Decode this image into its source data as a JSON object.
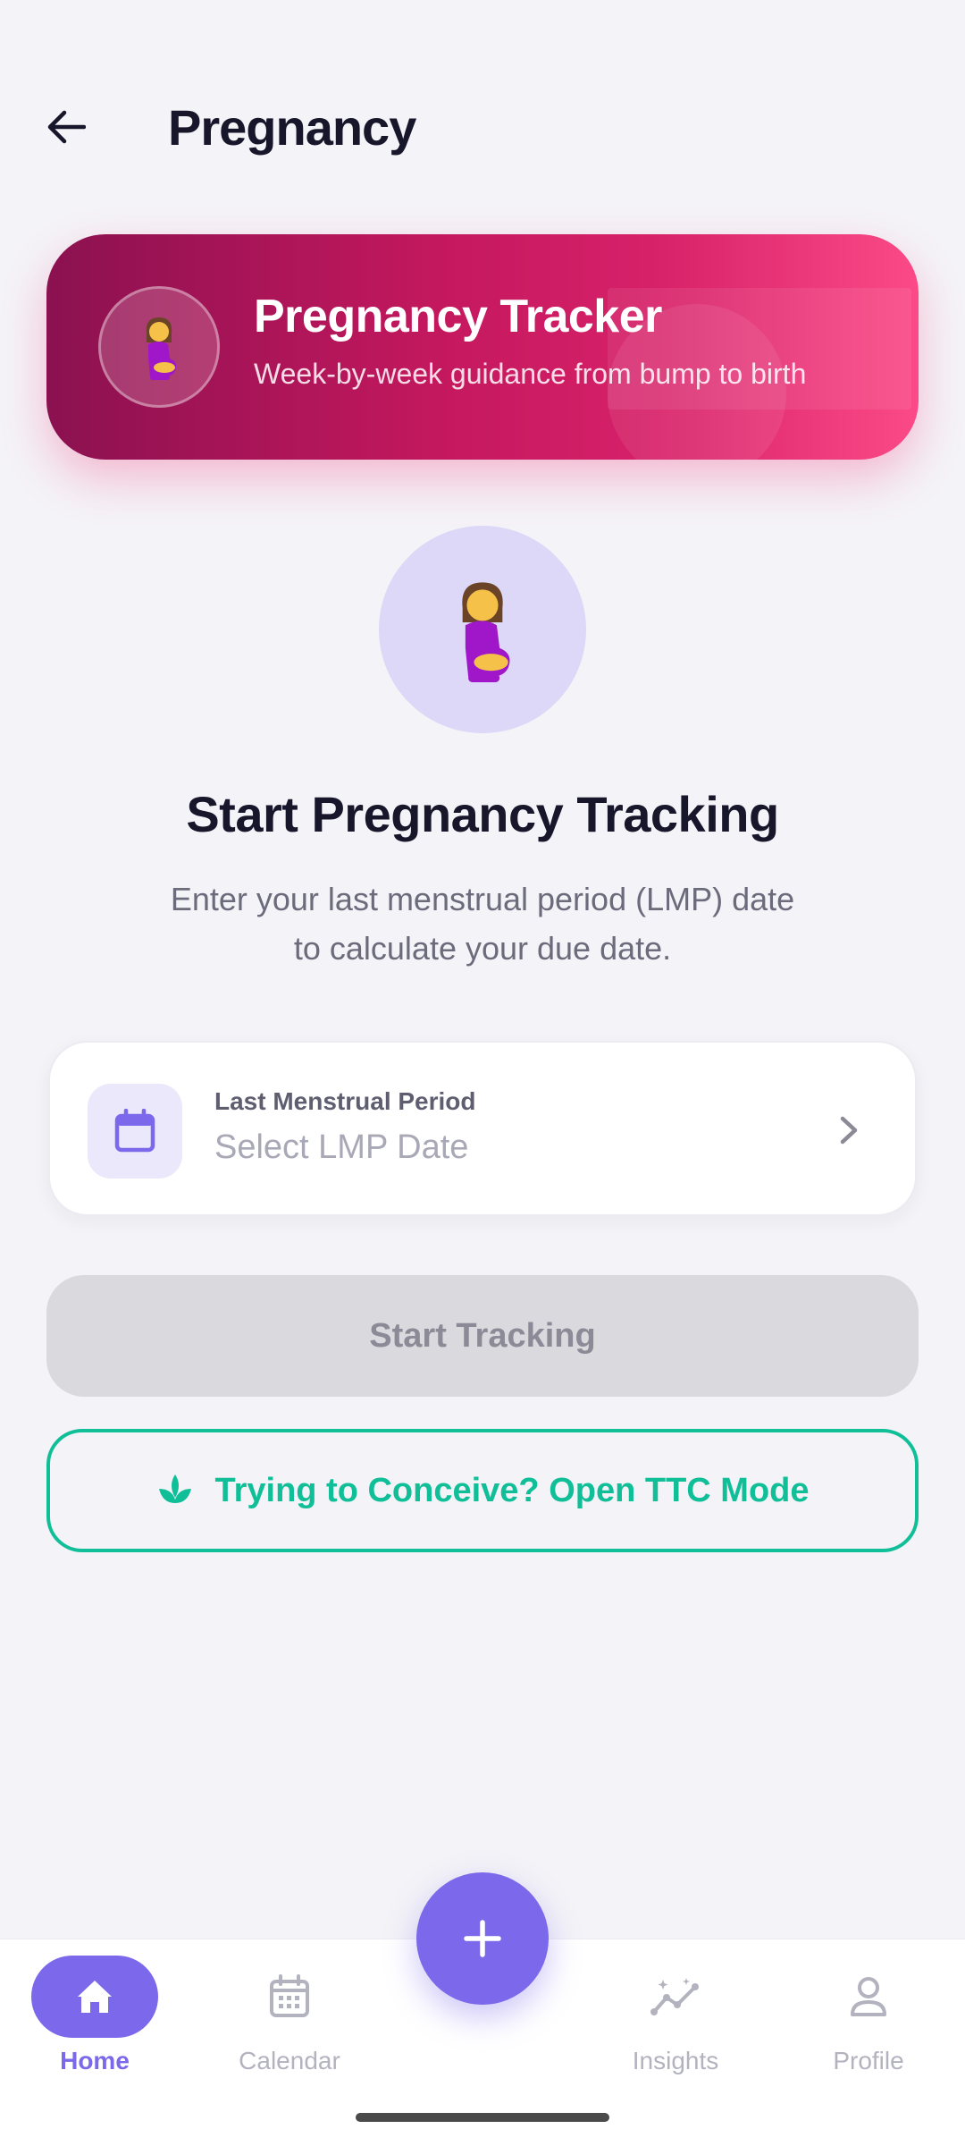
{
  "header": {
    "title": "Pregnancy",
    "back_icon": "arrow-left-icon"
  },
  "banner": {
    "title": "Pregnancy Tracker",
    "subtitle": "Week-by-week guidance from bump to birth",
    "icon": "pregnant-woman-emoji",
    "gradient": [
      "#8b1150",
      "#fb4a87"
    ]
  },
  "hero": {
    "icon": "pregnant-woman-emoji",
    "title": "Start Pregnancy Tracking",
    "description_line1": "Enter your last menstrual period (LMP) date",
    "description_line2": "to calculate your due date."
  },
  "lmp": {
    "label": "Last Menstrual Period",
    "placeholder": "Select LMP Date",
    "icon": "calendar-icon"
  },
  "buttons": {
    "start_tracking": "Start Tracking",
    "ttc": "Trying to Conceive? Open TTC Mode",
    "ttc_icon": "sprout-icon"
  },
  "nav": {
    "items": [
      {
        "label": "Home",
        "icon": "home-icon",
        "active": true
      },
      {
        "label": "Calendar",
        "icon": "calendar-icon",
        "active": false
      },
      {
        "label": "Insights",
        "icon": "insights-icon",
        "active": false
      },
      {
        "label": "Profile",
        "icon": "profile-icon",
        "active": false
      }
    ],
    "fab_icon": "plus-icon"
  },
  "colors": {
    "accent": "#7b68ea",
    "ttc_green": "#10bf98",
    "background": "#f4f3f7",
    "banner_pink": "#d72169"
  }
}
